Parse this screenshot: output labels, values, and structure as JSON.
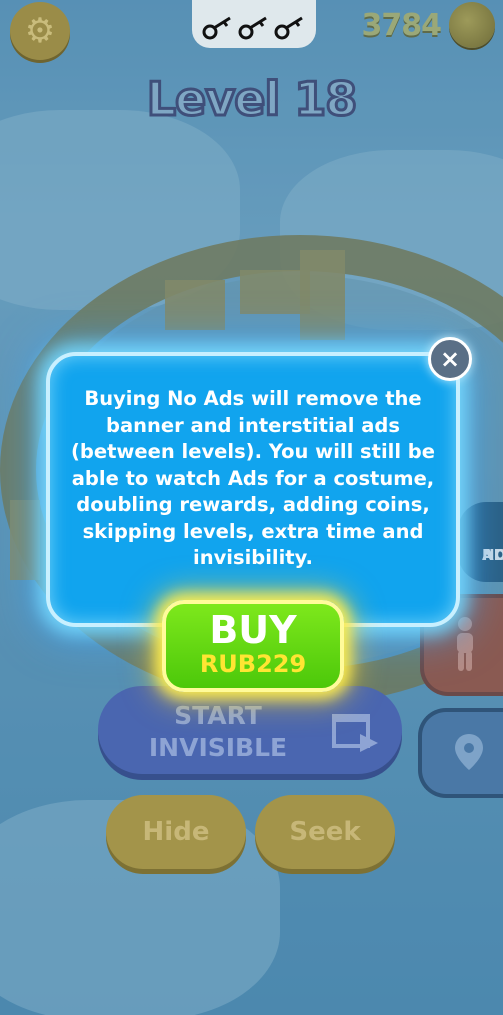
{
  "hud": {
    "settings_icon": "gear-icon",
    "keys_icons": [
      "key-icon",
      "key-icon",
      "key-icon"
    ],
    "coin_count": "3784",
    "coin_icon": "coin-icon",
    "level_title": "Level 18"
  },
  "side_buttons": {
    "no_ads_label_line1": "NO",
    "no_ads_label_line2": "ADS",
    "costume_icon": "person-icon",
    "map_icon": "location-pin-icon"
  },
  "main_buttons": {
    "start_line1": "START",
    "start_line2": "INVISIBLE",
    "start_icon": "video-ad-icon",
    "hide_label": "Hide",
    "seek_label": "Seek"
  },
  "modal": {
    "message": "Buying No Ads will remove the banner and interstitial ads (between levels). You will still be able to watch Ads for a costume, doubling rewards, adding coins, skipping levels, extra time and invisibility.",
    "close_symbol": "×",
    "buy_label": "BUY",
    "buy_price": "RUB229"
  },
  "colors": {
    "modal_bg": "#11a4ee",
    "buy_green": "#4cc80a",
    "price_yellow": "#ffe533"
  }
}
